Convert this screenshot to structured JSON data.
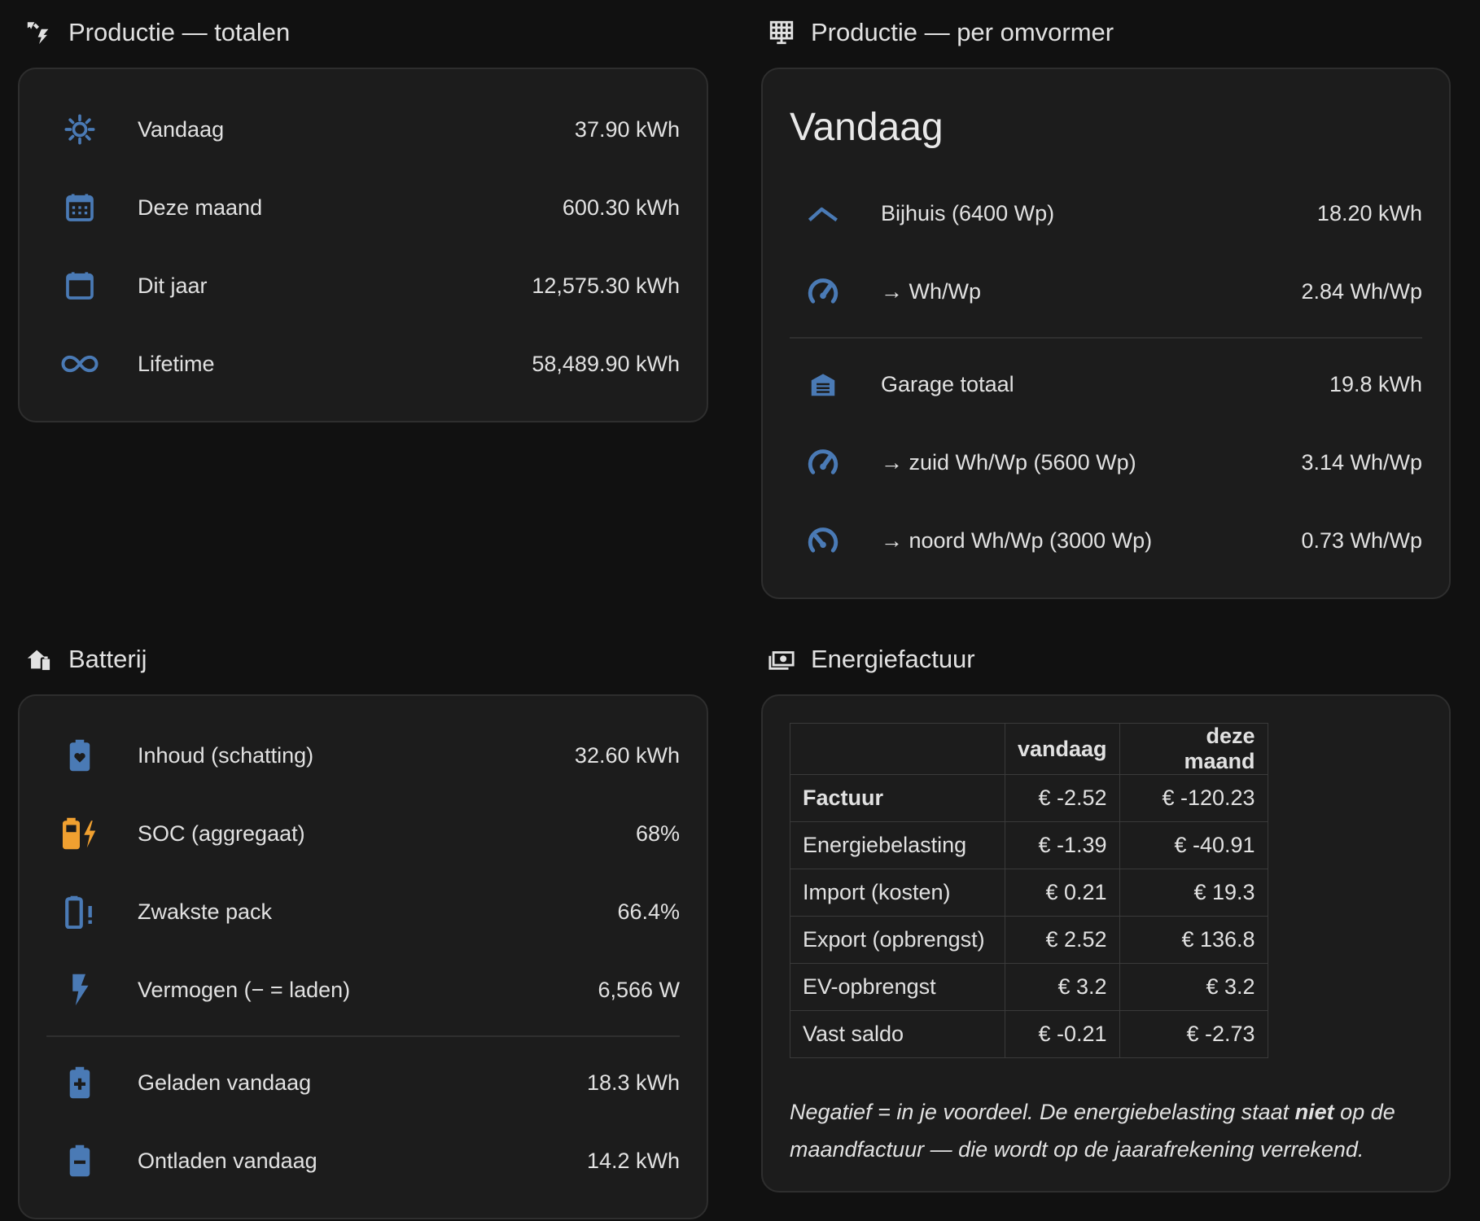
{
  "production_totals": {
    "title": "Productie — totalen",
    "icon": "solar-power-icon",
    "rows": [
      {
        "icon": "sun-icon",
        "label": "Vandaag",
        "value": "37.90 kWh"
      },
      {
        "icon": "calendar-month-icon",
        "label": "Deze maand",
        "value": "600.30 kWh"
      },
      {
        "icon": "calendar-blank-icon",
        "label": "Dit jaar",
        "value": "12,575.30 kWh"
      },
      {
        "icon": "infinity-icon",
        "label": "Lifetime",
        "value": "58,489.90 kWh"
      }
    ]
  },
  "production_per_inverter": {
    "title": "Productie — per omvormer",
    "icon": "solar-panel-icon",
    "card_title": "Vandaag",
    "rows": [
      {
        "icon": "roof-icon",
        "label": "Bijhuis (6400 Wp)",
        "value": "18.20 kWh"
      },
      {
        "icon": "gauge-icon",
        "label": "→ Wh/Wp",
        "value": "2.84 Wh/Wp"
      },
      {
        "icon": "garage-icon",
        "label": "Garage totaal",
        "value": "19.8 kWh"
      },
      {
        "icon": "gauge-icon",
        "label": "→ zuid Wh/Wp (5600 Wp)",
        "value": "3.14 Wh/Wp"
      },
      {
        "icon": "gauge-low-icon",
        "label": "→ noord Wh/Wp (3000 Wp)",
        "value": "0.73 Wh/Wp"
      }
    ]
  },
  "battery": {
    "title": "Batterij",
    "icon": "home-battery-icon",
    "rows": [
      {
        "icon": "battery-heart-icon",
        "label": "Inhoud (schatting)",
        "value": "32.60 kWh"
      },
      {
        "icon": "battery-charging-icon",
        "label": "SOC (aggregaat)",
        "value": "68%"
      },
      {
        "icon": "battery-alert-icon",
        "label": "Zwakste pack",
        "value": "66.4%"
      },
      {
        "icon": "lightning-bolt-icon",
        "label": "Vermogen (− = laden)",
        "value": "6,566 W"
      },
      {
        "icon": "battery-plus-icon",
        "label": "Geladen vandaag",
        "value": "18.3 kWh"
      },
      {
        "icon": "battery-minus-icon",
        "label": "Ontladen vandaag",
        "value": "14.2 kWh"
      }
    ]
  },
  "bill": {
    "title": "Energiefactuur",
    "icon": "cash-icon",
    "headers": [
      "",
      "vandaag",
      "deze maand"
    ],
    "rows": [
      {
        "label": "Factuur",
        "today": "€ -2.52",
        "month": "€ -120.23"
      },
      {
        "label": "Energiebelasting",
        "today": "€ -1.39",
        "month": "€ -40.91"
      },
      {
        "label": "Import (kosten)",
        "today": "€ 0.21",
        "month": "€ 19.3"
      },
      {
        "label": "Export (opbrengst)",
        "today": "€ 2.52",
        "month": "€ 136.8"
      },
      {
        "label": "EV-opbrengst",
        "today": "€ 3.2",
        "month": "€ 3.2"
      },
      {
        "label": "Vast saldo",
        "today": "€ -0.21",
        "month": "€ -2.73"
      }
    ],
    "note_part1": "Negatief = in je voordeel. De energiebelasting staat ",
    "note_bold": "niet",
    "note_part2": " op de maandfactuur — die wordt op de jaarafrekening verrekend."
  },
  "colors": {
    "icon_blue": "#4a7ab5",
    "icon_orange": "#f0a030",
    "background": "#111111",
    "card": "#1c1c1c"
  }
}
